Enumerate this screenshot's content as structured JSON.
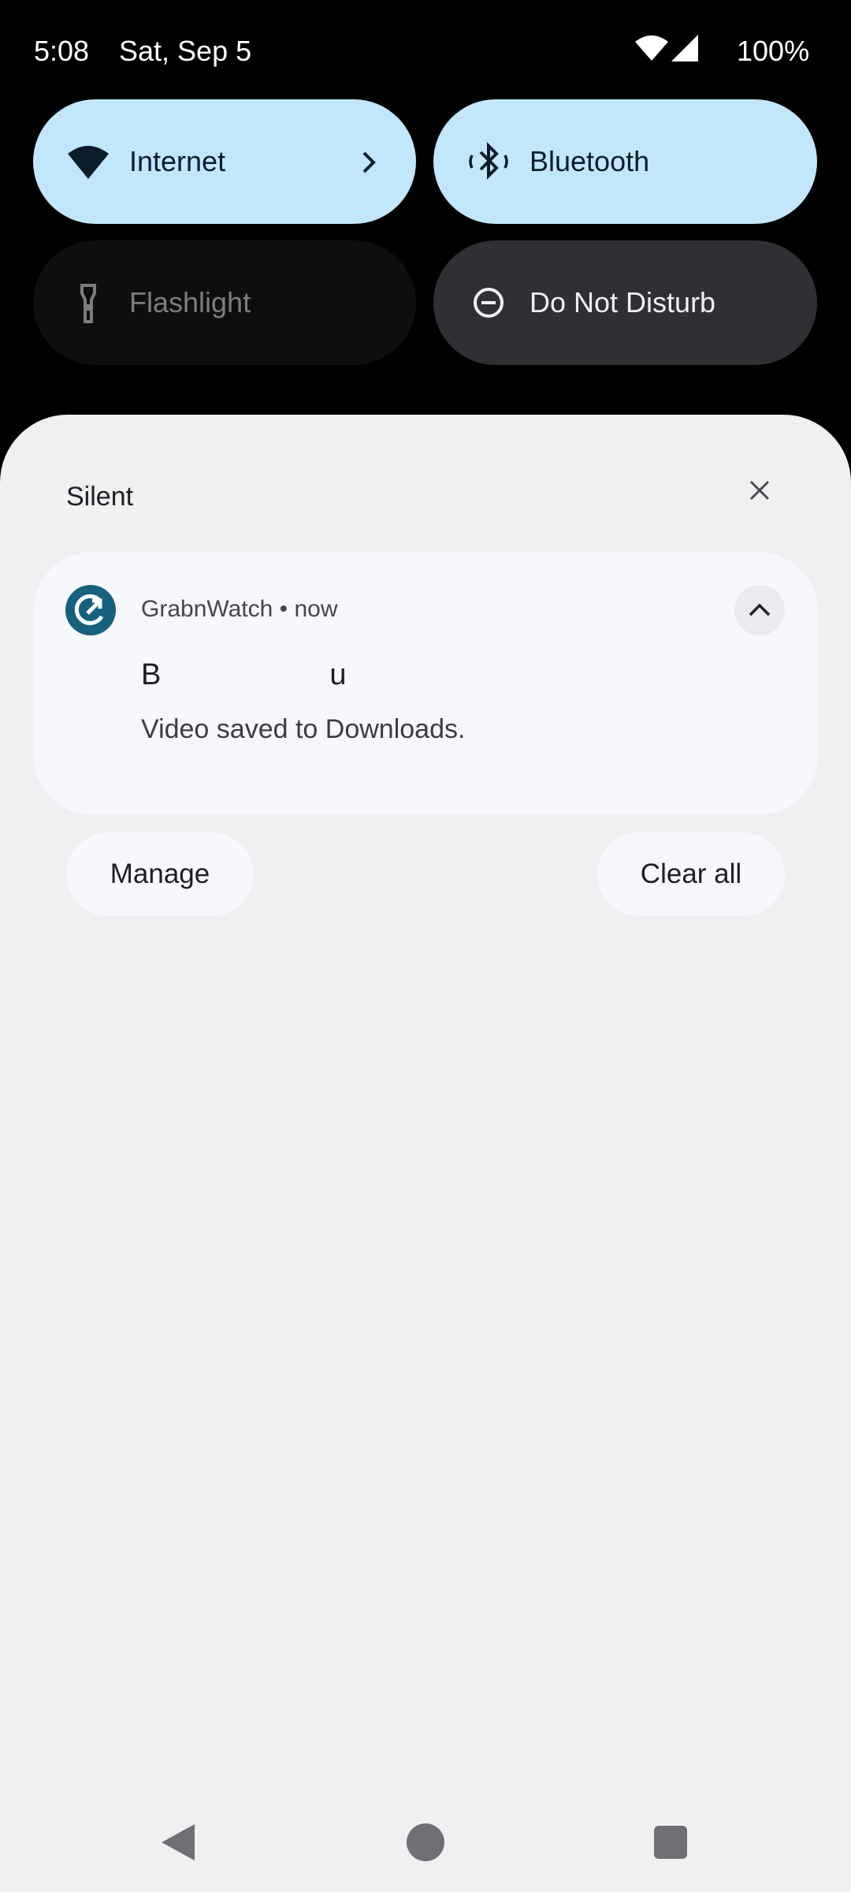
{
  "status_bar": {
    "time": "5:08",
    "date": "Sat, Sep 5",
    "battery": "100%",
    "icons": [
      "wifi-icon",
      "cell-signal-icon"
    ]
  },
  "quick_settings": {
    "tiles": [
      {
        "label": "Internet",
        "icon": "wifi-icon",
        "state": "on"
      },
      {
        "label": "Bluetooth",
        "icon": "bluetooth-icon",
        "state": "on"
      },
      {
        "label": "Flashlight",
        "icon": "flashlight-icon",
        "state": "off"
      },
      {
        "label": "Do Not Disturb",
        "icon": "do-not-disturb-icon",
        "state": "off"
      }
    ]
  },
  "shade": {
    "section_title": "Silent",
    "notification": {
      "app_name": "GrabnWatch",
      "separator": "•",
      "time": "now",
      "title_visible": "B",
      "title_tail": "u",
      "text": "Video saved to Downloads."
    },
    "manage_label": "Manage",
    "clear_all_label": "Clear all"
  },
  "colors": {
    "tile_active": "#c2e7fd",
    "tile_inactive": "#0e0e0e",
    "tile_dnd": "#2e3033",
    "shade_bg": "#eff0f2",
    "card_bg": "#f6f8fb",
    "app_icon": "#16627e"
  },
  "nav": {
    "icons": [
      "back-icon",
      "home-icon",
      "recents-icon"
    ]
  }
}
